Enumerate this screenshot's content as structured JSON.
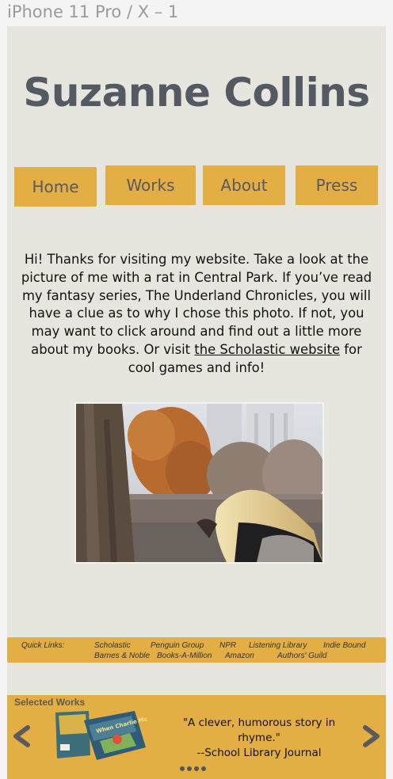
{
  "frame": {
    "label": "iPhone 11 Pro / X – 1"
  },
  "site": {
    "title": "Suzanne Collins"
  },
  "nav": {
    "home": "Home",
    "works": "Works",
    "about": "About",
    "press": "Press"
  },
  "intro": {
    "text_before": "Hi! Thanks for visiting my website. Take a look at the picture of me with a rat in Central Park. If you’ve read my fantasy series, The Underland Chronicles, you will have a clue as to why I chose this photo. If not, you may want to click around and find out a little more about my books. Or visit ",
    "link": "the Scholastic website",
    "text_after": " for cool games and info!"
  },
  "quick_links": {
    "label": "Quick Links:",
    "items": [
      "Scholastic",
      "Penguin Group",
      "NPR",
      "Listening Library",
      "Indie Bound",
      "Barnes & Noble",
      "Books-A-Million",
      "Amazon",
      "Authors' Guild"
    ]
  },
  "selected_works": {
    "title": "Selected Works",
    "quote": "\"A clever, humorous story in rhyme.\"",
    "source": "--School Library Journal",
    "book_title": "When Charlie McButton Lost Power",
    "slides": 4
  },
  "colors": {
    "accent": "#e3ae44",
    "background": "#e6e6df",
    "title": "#535a61"
  }
}
